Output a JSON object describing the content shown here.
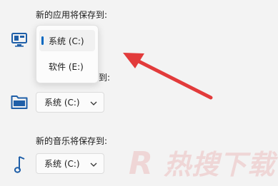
{
  "settings": {
    "apps": {
      "label": "新的应用将保存到:",
      "icon": "monitor-icon"
    },
    "documents": {
      "label_partial": "保存到:",
      "icon": "folder-icon",
      "value": "系统 (C:)"
    },
    "music": {
      "label": "新的音乐将保存到:",
      "icon": "music-note-icon",
      "value": "系统 (C:)"
    }
  },
  "menu": {
    "options": [
      {
        "label": "系统 (C:)",
        "selected": true
      },
      {
        "label": "软件 (E:)",
        "selected": false
      }
    ]
  },
  "colors": {
    "accent": "#0067c0",
    "arrow": "#e23b3b",
    "background": "#f3f3f3"
  },
  "watermark": "热搜下载"
}
